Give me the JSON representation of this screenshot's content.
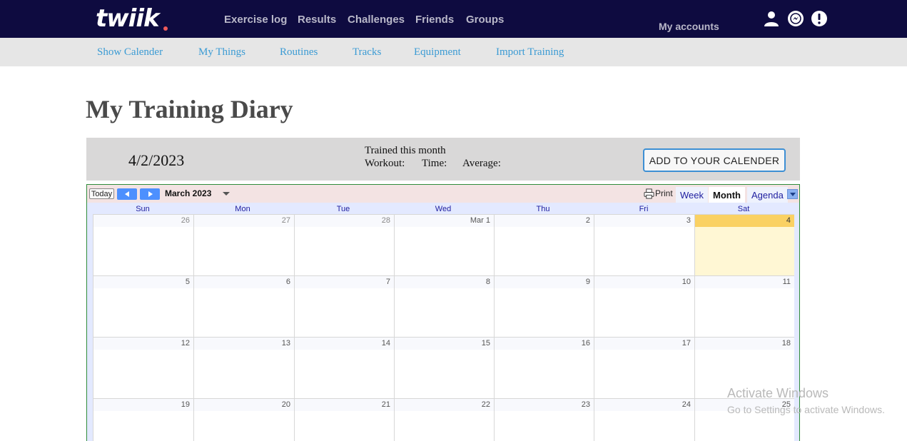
{
  "brand": {
    "logo_text": "twiik"
  },
  "top_nav": [
    {
      "label": "Exercise log"
    },
    {
      "label": "Results"
    },
    {
      "label": "Challenges"
    },
    {
      "label": "Friends"
    },
    {
      "label": "Groups"
    }
  ],
  "accounts_label": "My accounts",
  "top_icons": [
    "user-icon",
    "messenger-icon",
    "alert-icon"
  ],
  "sub_nav": [
    {
      "label": "Show Calender"
    },
    {
      "label": "My Things"
    },
    {
      "label": "Routines"
    },
    {
      "label": "Tracks"
    },
    {
      "label": "Equipment"
    },
    {
      "label": "Import Training"
    }
  ],
  "page_title": "My Training Diary",
  "summary": {
    "date": "4/2/2023",
    "trained_label": "Trained this month",
    "workout_label": "Workout:",
    "time_label": "Time:",
    "average_label": "Average:",
    "add_button": "ADD TO YOUR CALENDER"
  },
  "calendar": {
    "today_button": "Today",
    "month_label": "March 2023",
    "print_label": "Print",
    "views": [
      "Week",
      "Month",
      "Agenda"
    ],
    "active_view": "Month",
    "days_of_week": [
      "Sun",
      "Mon",
      "Tue",
      "Wed",
      "Thu",
      "Fri",
      "Sat"
    ],
    "weeks": [
      [
        "26",
        "27",
        "28",
        "Mar 1",
        "2",
        "3",
        "4"
      ],
      [
        "5",
        "6",
        "7",
        "8",
        "9",
        "10",
        "11"
      ],
      [
        "12",
        "13",
        "14",
        "15",
        "16",
        "17",
        "18"
      ],
      [
        "19",
        "20",
        "21",
        "22",
        "23",
        "24",
        "25"
      ]
    ],
    "other_month_days": [
      "26",
      "27",
      "28"
    ],
    "highlighted_day": "4",
    "colors": {
      "today_header": "#fad163",
      "today_fill": "#fff7d4",
      "accent": "#4d90fe"
    }
  },
  "watermark": {
    "line1": "Activate Windows",
    "line2": "Go to Settings to activate Windows."
  },
  "colors": {
    "topbar": "#0e0b40",
    "link": "#3b9bd4"
  }
}
